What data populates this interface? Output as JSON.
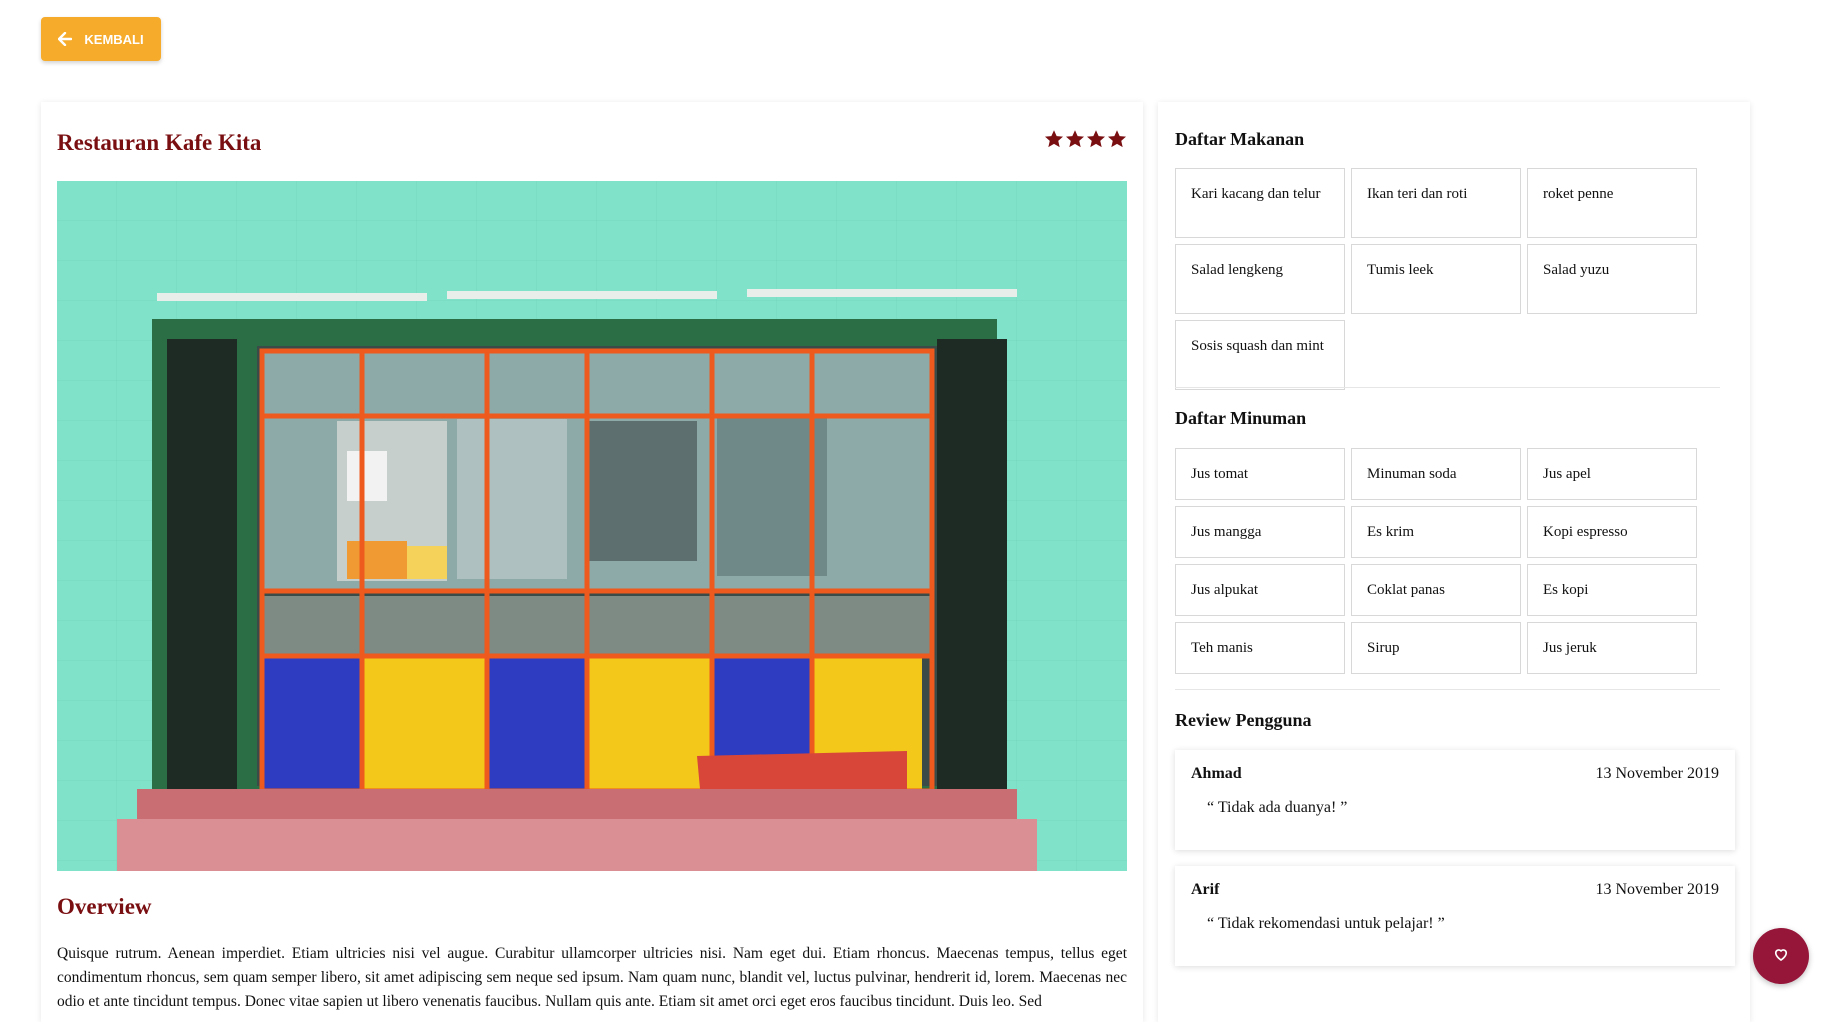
{
  "back_button": {
    "label": "KEMBALI",
    "icon": "arrow-left-icon"
  },
  "restaurant": {
    "name": "Restauran Kafe Kita",
    "rating": 4,
    "rating_max": 4,
    "image_alt": "storefront-photo"
  },
  "overview": {
    "title": "Overview",
    "text": "Quisque rutrum. Aenean imperdiet. Etiam ultricies nisi vel augue. Curabitur ullamcorper ultricies nisi. Nam eget dui. Etiam rhoncus. Maecenas tempus, tellus eget condimentum rhoncus, sem quam semper libero, sit amet adipiscing sem neque sed ipsum. Nam quam nunc, blandit vel, luctus pulvinar, hendrerit id, lorem. Maecenas nec odio et ante tincidunt tempus. Donec vitae sapien ut libero venenatis faucibus. Nullam quis ante. Etiam sit amet orci eget eros faucibus tincidunt. Duis leo. Sed"
  },
  "foods": {
    "title": "Daftar Makanan",
    "items": [
      "Kari kacang dan telur",
      "Ikan teri dan roti",
      "roket penne",
      "Salad lengkeng",
      "Tumis leek",
      "Salad yuzu",
      "Sosis squash dan mint"
    ]
  },
  "drinks": {
    "title": "Daftar Minuman",
    "items": [
      "Jus tomat",
      "Minuman soda",
      "Jus apel",
      "Jus mangga",
      "Es krim",
      "Kopi espresso",
      "Jus alpukat",
      "Coklat panas",
      "Es kopi",
      "Teh manis",
      "Sirup",
      "Jus jeruk"
    ]
  },
  "reviews": {
    "title": "Review Pengguna",
    "items": [
      {
        "name": "Ahmad",
        "date": "13 November 2019",
        "text": "“ Tidak ada duanya! ”"
      },
      {
        "name": "Arif",
        "date": "13 November 2019",
        "text": "“ Tidak rekomendasi untuk pelajar! ”"
      }
    ]
  },
  "colors": {
    "accent_orange": "#f6ab2b",
    "title_maroon": "#7a0f12",
    "fab_crimson": "#96163a"
  },
  "fab": {
    "icon": "heart-icon"
  }
}
